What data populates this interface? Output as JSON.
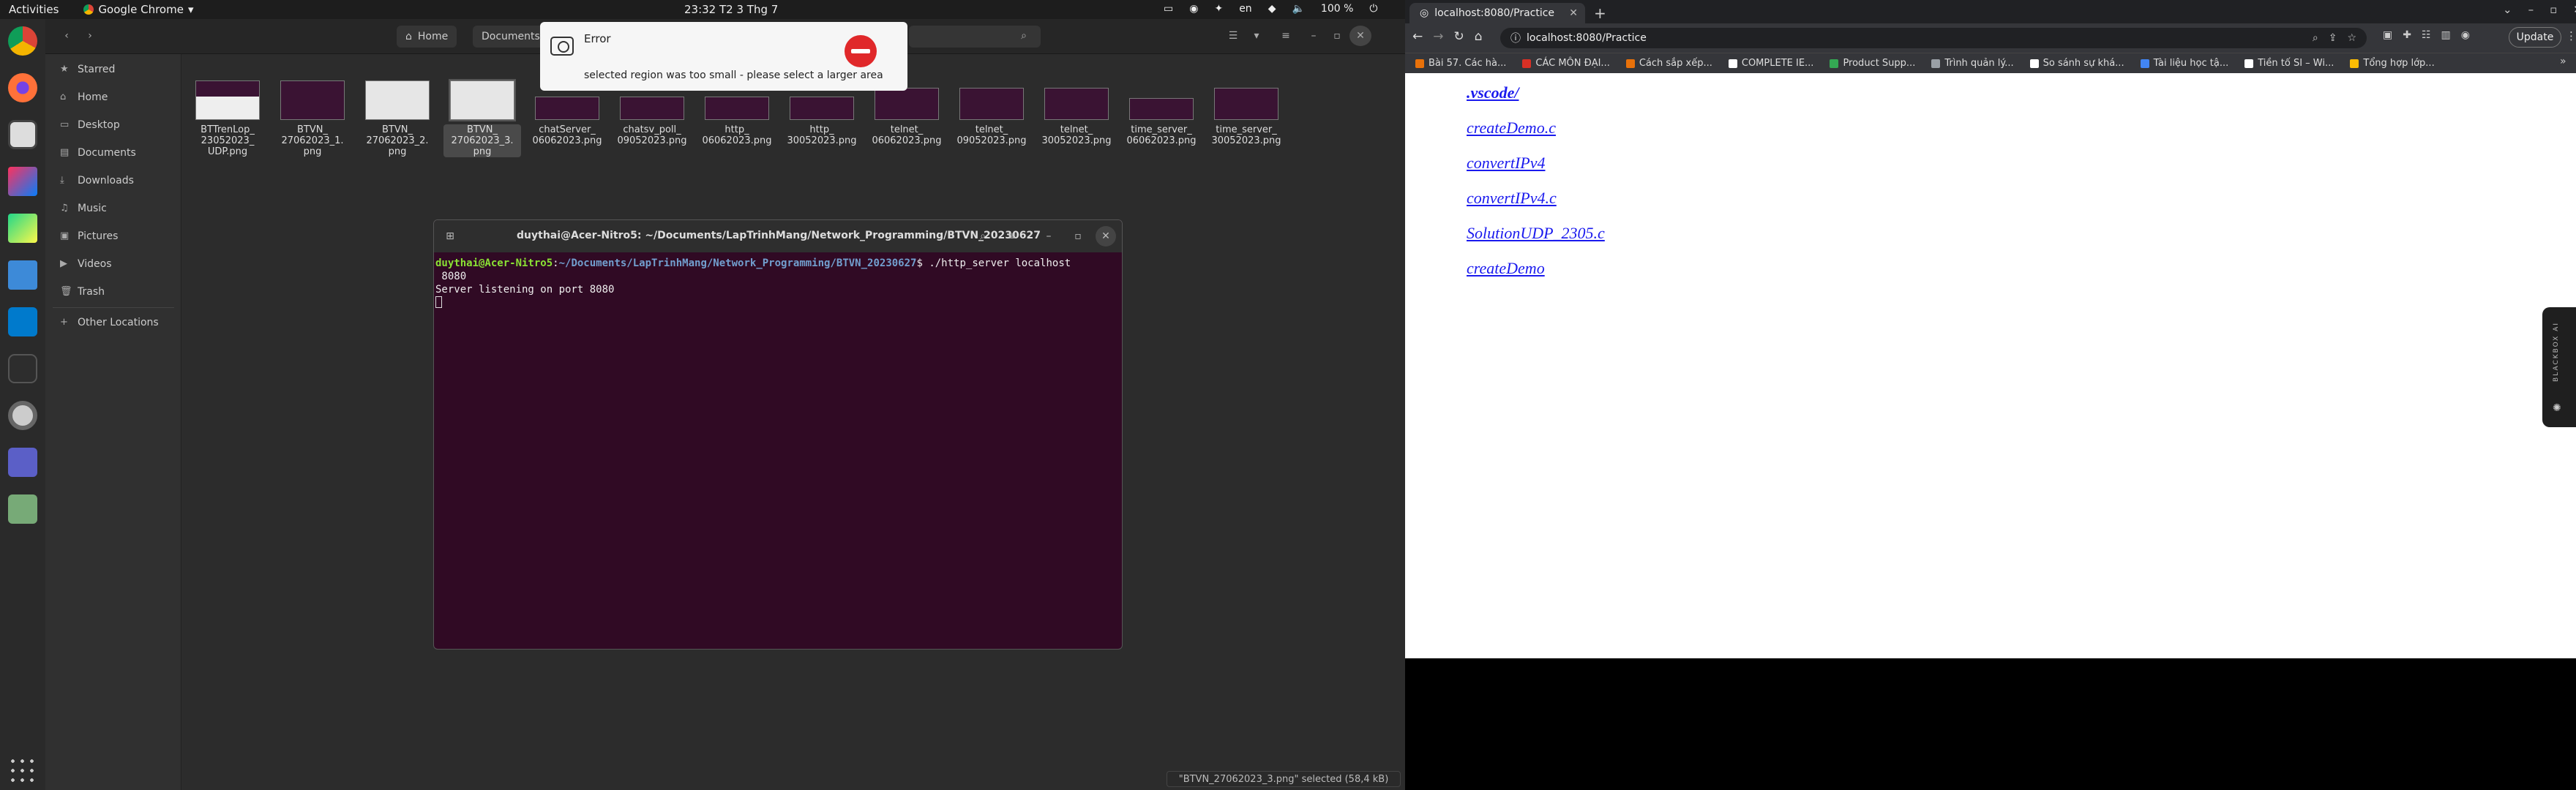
{
  "topbar": {
    "activities": "Activities",
    "app_name": "Google Chrome",
    "clock": "23:32  T2 3 Thg 7",
    "lang": "en",
    "battery": "100 %"
  },
  "files": {
    "breadcrumb_home": "Home",
    "breadcrumb_documents": "Documents",
    "sidebar": [
      {
        "label": "Starred",
        "icon": "star-icon"
      },
      {
        "label": "Home",
        "icon": "home-icon"
      },
      {
        "label": "Desktop",
        "icon": "desktop-icon"
      },
      {
        "label": "Documents",
        "icon": "document-icon"
      },
      {
        "label": "Downloads",
        "icon": "download-icon"
      },
      {
        "label": "Music",
        "icon": "music-icon"
      },
      {
        "label": "Pictures",
        "icon": "picture-icon"
      },
      {
        "label": "Videos",
        "icon": "video-icon"
      },
      {
        "label": "Trash",
        "icon": "trash-icon"
      },
      {
        "label": "Other Locations",
        "icon": "plus-icon"
      }
    ],
    "items": [
      {
        "line1": "BTTrenLop_",
        "line2": "23052023_",
        "line3": "UDP.png"
      },
      {
        "line1": "BTVN_",
        "line2": "27062023_1.",
        "line3": "png"
      },
      {
        "line1": "BTVN_",
        "line2": "27062023_2.",
        "line3": "png"
      },
      {
        "line1": "BTVN_",
        "line2": "27062023_3.",
        "line3": "png"
      },
      {
        "line1": "chatServer_",
        "line2": "06062023.png",
        "line3": ""
      },
      {
        "line1": "chatsv_poll_",
        "line2": "09052023.png",
        "line3": ""
      },
      {
        "line1": "http_",
        "line2": "06062023.png",
        "line3": ""
      },
      {
        "line1": "http_",
        "line2": "30052023.png",
        "line3": ""
      },
      {
        "line1": "telnet_",
        "line2": "06062023.png",
        "line3": ""
      },
      {
        "line1": "telnet_",
        "line2": "09052023.png",
        "line3": ""
      },
      {
        "line1": "telnet_",
        "line2": "30052023.png",
        "line3": ""
      },
      {
        "line1": "time_server_",
        "line2": "06062023.png",
        "line3": ""
      },
      {
        "line1": "time_server_",
        "line2": "30052023.png",
        "line3": ""
      }
    ],
    "status": "\"BTVN_27062023_3.png\" selected  (58,4 kB)"
  },
  "error_popup": {
    "title": "Error",
    "message": "selected region was too small - please select a larger area"
  },
  "terminal": {
    "title": "duythai@Acer-Nitro5: ~/Documents/LapTrinhMang/Network_Programming/BTVN_20230627",
    "prompt_user": "duythai@Acer-Nitro5",
    "prompt_path": "~/Documents/LapTrinhMang/Network_Programming/BTVN_20230627",
    "command": "$ ./http_server localhost",
    "command_cont": " 8080",
    "output": "Server listening on port 8080"
  },
  "chrome": {
    "tab_title": "localhost:8080/Practice",
    "url": "localhost:8080/Practice",
    "update_label": "Update",
    "bookmarks": [
      {
        "label": "Bài 57. Các hà...",
        "color": "#e8710a"
      },
      {
        "label": "CÁC MÔN ĐẠI...",
        "color": "#d93025"
      },
      {
        "label": "Cách sắp xếp...",
        "color": "#e8710a"
      },
      {
        "label": "COMPLETE IE...",
        "color": "#ffffff"
      },
      {
        "label": "Product Supp...",
        "color": "#34a853"
      },
      {
        "label": "Trình quản lý...",
        "color": "#9aa0a6"
      },
      {
        "label": "So sánh sự khá...",
        "color": "#ffffff"
      },
      {
        "label": "Tài liệu học tậ...",
        "color": "#4285f4"
      },
      {
        "label": "Tiền tố SI – Wi...",
        "color": "#ffffff"
      },
      {
        "label": "Tổng hợp lớp...",
        "color": "#fbbc04"
      }
    ],
    "links": [
      ".vscode/",
      "createDemo.c",
      "convertIPv4",
      "convertIPv4.c",
      "SolutionUDP_2305.c",
      "createDemo"
    ],
    "sidebar_widget": "BLACKBOX AI"
  }
}
